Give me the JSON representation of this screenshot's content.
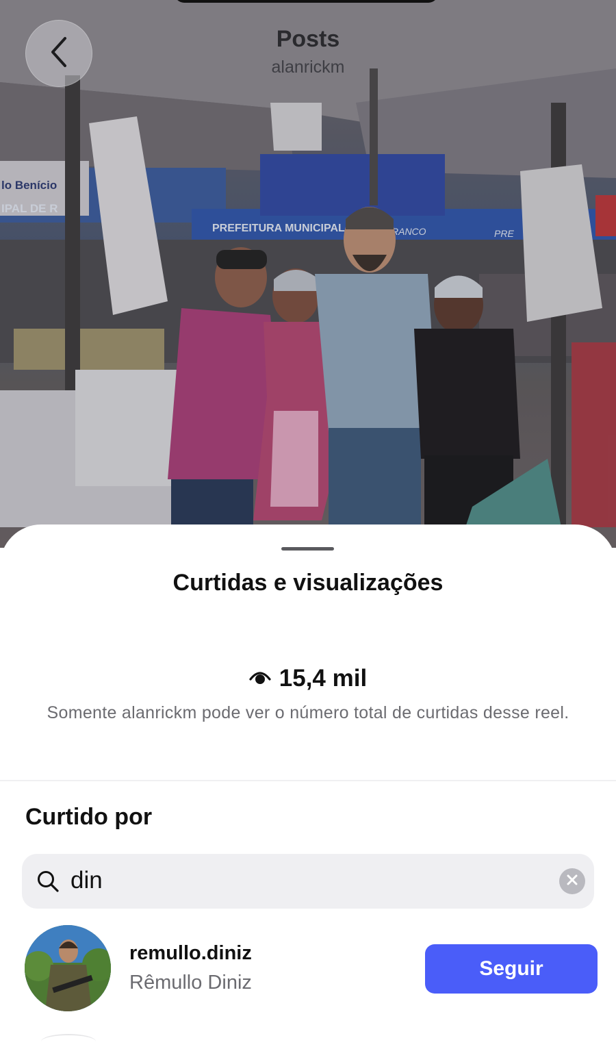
{
  "header": {
    "title": "Posts",
    "subtitle": "alanrickm",
    "back_icon": "chevron-left-icon"
  },
  "photo": {
    "signs": [
      "lo Benício",
      "IPAL DE R",
      "PREFEITURA MUNICIPAL",
      "RANCO",
      "PRE"
    ]
  },
  "sheet": {
    "title": "Curtidas e visualizações",
    "views_icon": "eye-icon",
    "views_count": "15,4 mil",
    "notice": "Somente alanrickm pode ver o número total de curtidas desse reel.",
    "liked_by_label": "Curtido por",
    "search": {
      "icon": "search-icon",
      "value": "din",
      "clear_icon": "clear-icon"
    },
    "users": [
      {
        "username": "remullo.diniz",
        "full_name": "Rêmullo Diniz",
        "follow_label": "Seguir"
      }
    ]
  },
  "colors": {
    "follow_button": "#4a5df9",
    "search_background": "#efeff2",
    "secondary_text": "#6b6b70"
  }
}
